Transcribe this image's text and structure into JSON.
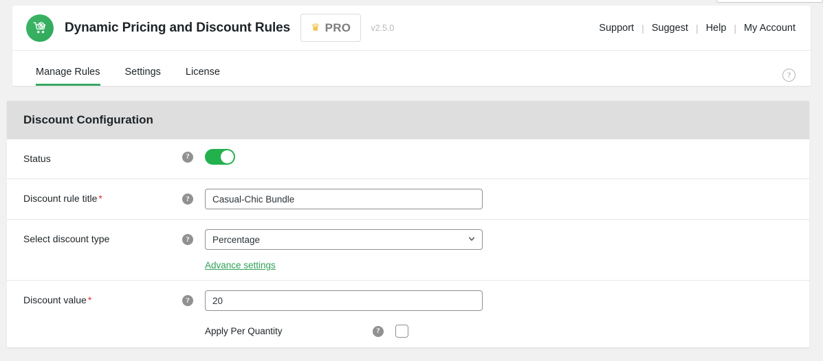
{
  "header": {
    "logo_icon": "shopping-cart-percent-icon",
    "title": "Dynamic Pricing and Discount Rules",
    "pro_badge": {
      "crown_icon": "crown-icon",
      "label": "PRO"
    },
    "version": "v2.5.0",
    "nav": [
      {
        "label": "Support"
      },
      {
        "label": "Suggest"
      },
      {
        "label": "Help"
      },
      {
        "label": "My Account"
      }
    ],
    "nav_separator": "|"
  },
  "tabs": [
    {
      "label": "Manage Rules",
      "active": true
    },
    {
      "label": "Settings",
      "active": false
    },
    {
      "label": "License",
      "active": false
    }
  ],
  "tab_help_icon": "question-circle-icon",
  "panel": {
    "heading": "Discount Configuration",
    "rows": {
      "status": {
        "label": "Status",
        "help_icon": "help-icon",
        "toggle_on": true
      },
      "rule_title": {
        "label": "Discount rule title",
        "required_mark": "*",
        "help_icon": "help-icon",
        "value": "Casual-Chic Bundle",
        "placeholder": "Discount rule title"
      },
      "discount_type": {
        "label": "Select discount type",
        "help_icon": "help-icon",
        "selected": "Percentage",
        "chevron_icon": "chevron-down-icon",
        "advance_link": "Advance settings"
      },
      "discount_value": {
        "label": "Discount value",
        "required_mark": "*",
        "help_icon": "help-icon",
        "value": "20",
        "placeholder": "Discount value",
        "apply_per_quantity": {
          "label": "Apply Per Quantity",
          "help_icon": "help-icon",
          "checked": false
        }
      }
    }
  },
  "colors": {
    "brand_green": "#2fa157",
    "toggle_green": "#22b14c",
    "panel_header_gray": "#dedede",
    "required_red": "#e02b2b",
    "crown_gold": "#f0b429"
  }
}
